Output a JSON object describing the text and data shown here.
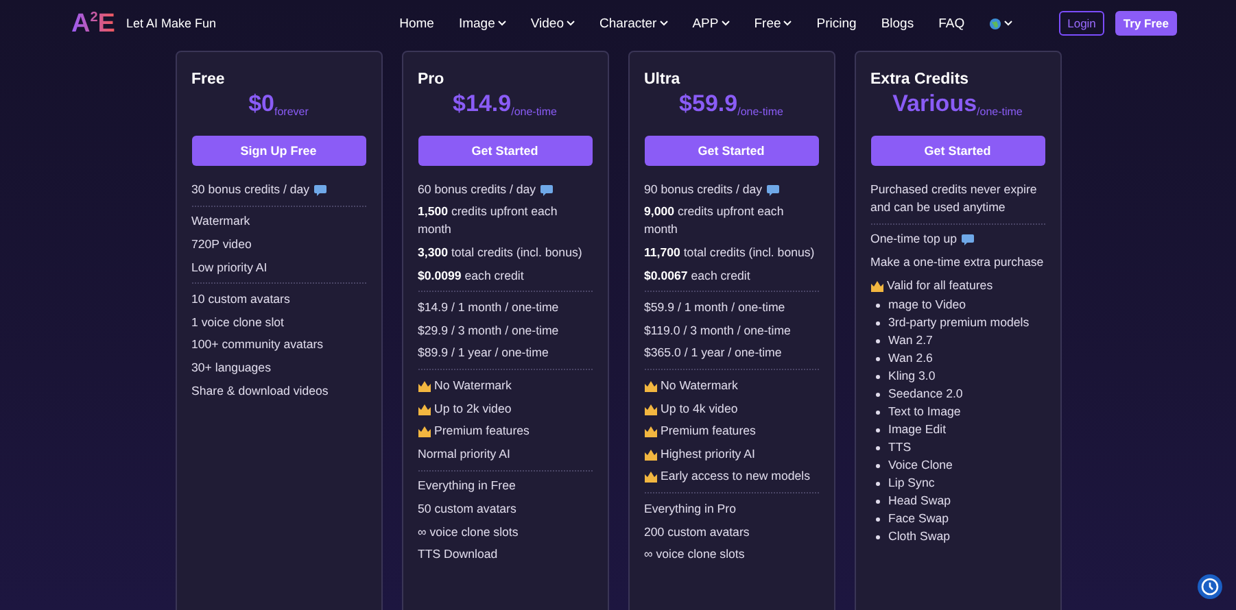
{
  "header": {
    "logo": "A$^{2}$E",
    "tagline": "Let AI Make Fun",
    "nav": [
      {
        "label": "Home",
        "has_menu": false
      },
      {
        "label": "Image",
        "has_menu": true
      },
      {
        "label": "Video",
        "has_menu": true
      },
      {
        "label": "Character",
        "has_menu": true
      },
      {
        "label": "APP",
        "has_menu": true
      },
      {
        "label": "Free",
        "has_menu": true
      },
      {
        "label": "Pricing",
        "has_menu": false
      },
      {
        "label": "Blogs",
        "has_menu": false
      },
      {
        "label": "FAQ",
        "has_menu": false
      }
    ],
    "login": "Login",
    "try_free": "Try Free"
  },
  "plans": [
    {
      "title": "Free",
      "price": "$0",
      "period": "forever",
      "button": "Sign Up Free",
      "sections": [
        [
          {
            "kind": "note",
            "text": "30 bonus credits / day"
          }
        ],
        [
          {
            "kind": "plain",
            "text": "Watermark"
          },
          {
            "kind": "plain",
            "text": "720P video"
          },
          {
            "kind": "plain",
            "text": "Low priority AI"
          }
        ],
        [
          {
            "kind": "plain",
            "text": "10 custom avatars"
          },
          {
            "kind": "plain",
            "text": "1 voice clone slot"
          },
          {
            "kind": "plain",
            "text": "100+ community avatars"
          },
          {
            "kind": "plain",
            "text": "30+ languages"
          },
          {
            "kind": "plain",
            "text": "Share & download videos"
          }
        ]
      ]
    },
    {
      "title": "Pro",
      "price": "$14.9",
      "period": "/one-time",
      "button": "Get Started",
      "sections": [
        [
          {
            "kind": "note",
            "text": "60 bonus credits / day"
          },
          {
            "kind": "plain",
            "text": "**1,500** credits upfront each month"
          },
          {
            "kind": "plain",
            "text": "**3,300** total credits (incl. bonus)"
          },
          {
            "kind": "plain",
            "text": "**$0.0099** each credit"
          }
        ],
        [
          {
            "kind": "plain",
            "text": "$14.9 / 1 month / one-time"
          },
          {
            "kind": "plain",
            "text": "$29.9 / 3 month / one-time"
          },
          {
            "kind": "plain",
            "text": "$89.9 / 1 year / one-time"
          }
        ],
        [
          {
            "kind": "crown",
            "text": "No Watermark"
          },
          {
            "kind": "crown",
            "text": "Up to 2k video"
          },
          {
            "kind": "crown",
            "text": "Premium features"
          },
          {
            "kind": "plain",
            "text": "Normal priority AI"
          }
        ],
        [
          {
            "kind": "plain",
            "text": "Everything in Free"
          },
          {
            "kind": "plain",
            "text": "50 custom avatars"
          },
          {
            "kind": "plain",
            "text": "∞ voice clone slots"
          },
          {
            "kind": "plain",
            "text": "TTS Download"
          }
        ]
      ]
    },
    {
      "title": "Ultra",
      "price": "$59.9",
      "period": "/one-time",
      "button": "Get Started",
      "sections": [
        [
          {
            "kind": "note",
            "text": "90 bonus credits / day"
          },
          {
            "kind": "plain",
            "text": "**9,000** credits upfront each month"
          },
          {
            "kind": "plain",
            "text": "**11,700** total credits (incl. bonus)"
          },
          {
            "kind": "plain",
            "text": "**$0.0067** each credit"
          }
        ],
        [
          {
            "kind": "plain",
            "text": "$59.9 / 1 month / one-time"
          },
          {
            "kind": "plain",
            "text": "$119.0 / 3 month / one-time"
          },
          {
            "kind": "plain",
            "text": "$365.0 / 1 year / one-time"
          }
        ],
        [
          {
            "kind": "crown",
            "text": "No Watermark"
          },
          {
            "kind": "crown",
            "text": "Up to 4k video"
          },
          {
            "kind": "crown",
            "text": "Premium features"
          },
          {
            "kind": "crown",
            "text": "Highest priority AI"
          },
          {
            "kind": "crown",
            "text": "Early access to new models"
          }
        ],
        [
          {
            "kind": "plain",
            "text": "Everything in Pro"
          },
          {
            "kind": "plain",
            "text": "200 custom avatars"
          },
          {
            "kind": "plain",
            "text": "∞ voice clone slots"
          }
        ]
      ]
    },
    {
      "title": "Extra Credits",
      "price": "Various",
      "period": "/one-time",
      "button": "Get Started",
      "sections": [
        [
          {
            "kind": "plain",
            "text": "Purchased credits never expire and can be used anytime"
          }
        ],
        [
          {
            "kind": "note",
            "text": "One-time top up"
          },
          {
            "kind": "plain",
            "text": "Make a one-time extra purchase"
          },
          {
            "kind": "crown",
            "text": "Valid for all features"
          },
          {
            "kind": "bullet",
            "text": "mage to Video"
          },
          {
            "kind": "bullet",
            "text": "3rd-party premium models"
          },
          {
            "kind": "bullet",
            "text": "Wan 2.7"
          },
          {
            "kind": "bullet",
            "text": "Wan 2.6"
          },
          {
            "kind": "bullet",
            "text": "Kling 3.0"
          },
          {
            "kind": "bullet",
            "text": "Seedance 2.0"
          },
          {
            "kind": "bullet",
            "text": "Text to Image"
          },
          {
            "kind": "bullet",
            "text": "Image Edit"
          },
          {
            "kind": "bullet",
            "text": "TTS"
          },
          {
            "kind": "bullet",
            "text": "Voice Clone"
          },
          {
            "kind": "bullet",
            "text": "Lip Sync"
          },
          {
            "kind": "bullet",
            "text": "Head Swap"
          },
          {
            "kind": "bullet",
            "text": "Face Swap"
          },
          {
            "kind": "bullet",
            "text": "Cloth Swap"
          }
        ]
      ]
    }
  ]
}
